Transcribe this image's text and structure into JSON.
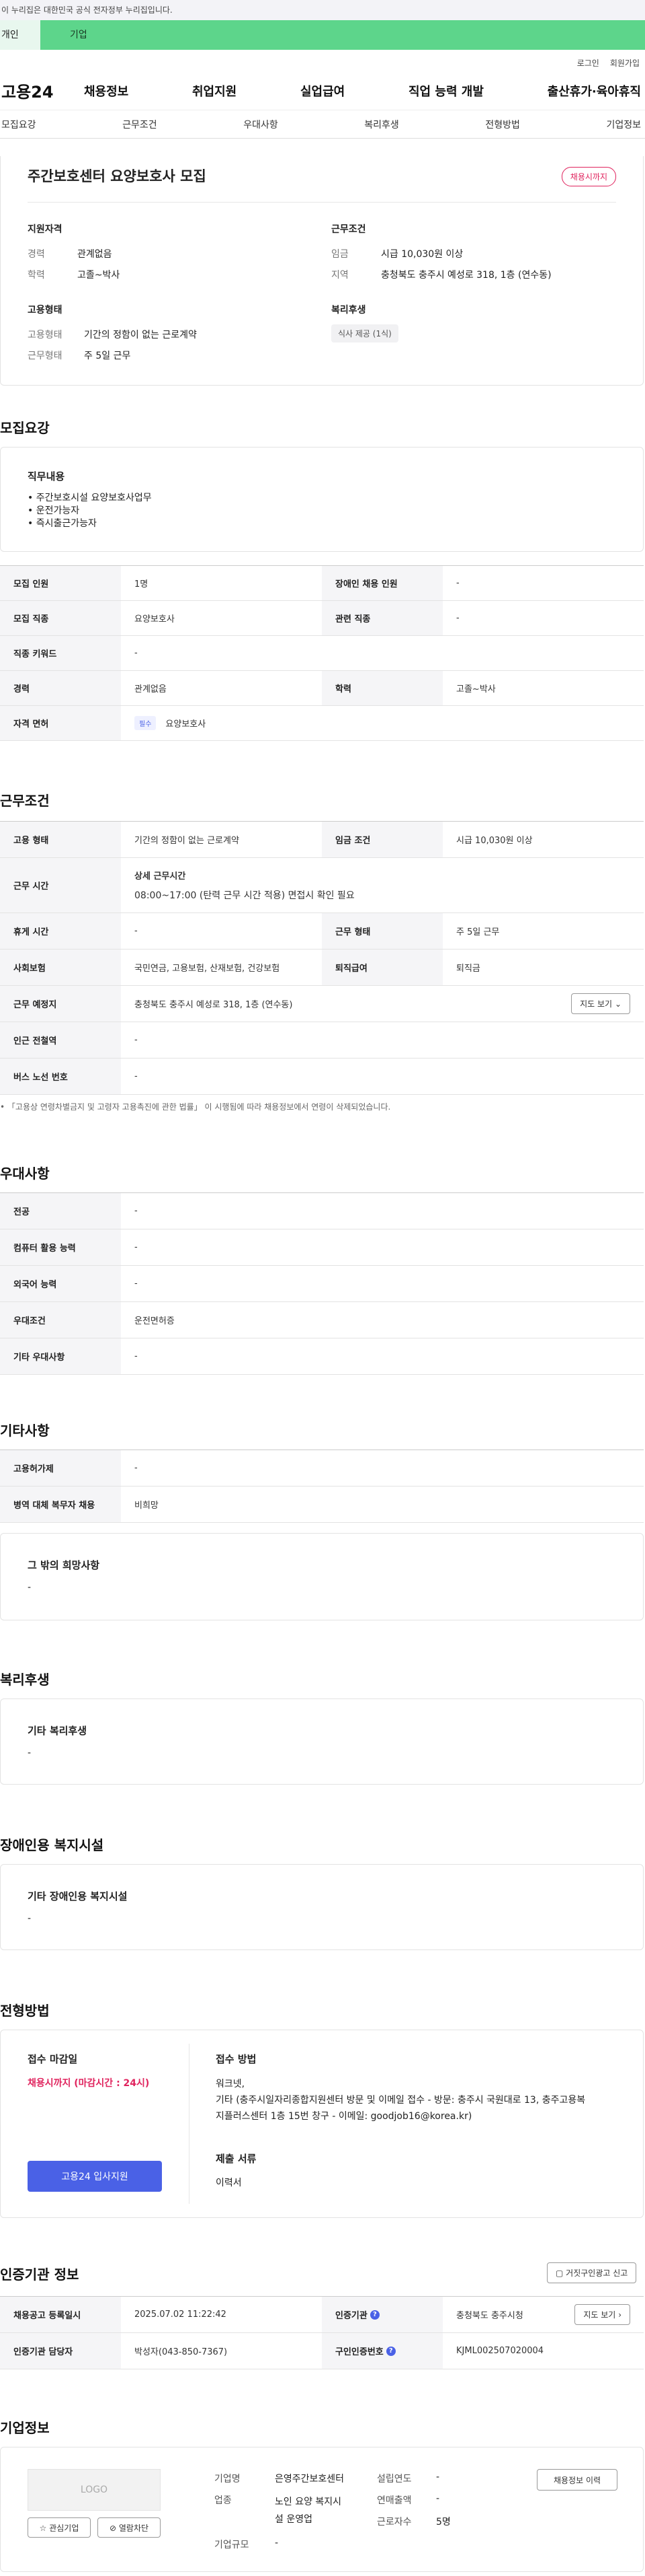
{
  "gov_banner": "이 누리집은 대한민국 공식 전자정부 누리집입니다.",
  "tabs": {
    "a": "개인",
    "b": "기업"
  },
  "util": {
    "login": "로그인",
    "signup": "회원가입"
  },
  "gnb": {
    "logo": "고용24",
    "menu": [
      "채용정보",
      "취업지원",
      "실업급여",
      "직업 능력 개발",
      "출산휴가·육아휴직"
    ]
  },
  "lnb": [
    "모집요강",
    "근무조건",
    "우대사항",
    "복리후생",
    "전형방법",
    "기업정보"
  ],
  "top": {
    "title": "주간보호센터 요양보호사 모집",
    "badge": "채용시까지",
    "qual_h": "지원자격",
    "career_k": "경력",
    "career_v": "관계없음",
    "edu_k": "학력",
    "edu_v": "고졸~박사",
    "emp_h": "고용형태",
    "emptype_k": "고용형태",
    "emptype_v": "기간의 정함이 없는 근로계약",
    "worktype_k": "근무형태",
    "worktype_v": "주 5일 근무",
    "cond_h": "근무조건",
    "wage_k": "임금",
    "wage_v": "시급 10,030원 이상",
    "region_k": "지역",
    "region_v": "충청북도 충주시 예성로 318, 1층 (연수동)",
    "welfare_h": "복리후생",
    "welfare_chip": "식사 제공 (1식)"
  },
  "recruit": {
    "heading": "모집요강",
    "duty_h": "직무내용",
    "duty_lines": [
      "• 주간보호시설 요양보호사업무",
      "• 운전가능자",
      "• 즉시출근가능자"
    ],
    "t": {
      "count_k": "모집 인원",
      "count_v": "1명",
      "disabled_k": "장애인 채용 인원",
      "disabled_v": "-",
      "job_k": "모집 직종",
      "job_v": "요양보호사",
      "related_k": "관련 직종",
      "related_v": "-",
      "kw_k": "직종 키워드",
      "kw_v": "-",
      "career_k": "경력",
      "career_v": "관계없음",
      "edu_k": "학력",
      "edu_v": "고졸~박사",
      "license_k": "자격 면허",
      "license_tag": "필수",
      "license_v": "요양보호사"
    }
  },
  "work": {
    "heading": "근무조건",
    "t": {
      "emptype_k": "고용 형태",
      "emptype_v": "기간의 정함이 없는 근로계약",
      "wage_k": "임금 조건",
      "wage_v": "시급 10,030원 이상",
      "time_k": "근무 시간",
      "time_sub": "상세 근무시간",
      "time_v": "08:00~17:00 (탄력 근무 시간 적용) 면접시 확인 필요",
      "rest_k": "휴게 시간",
      "rest_v": "-",
      "form_k": "근무 형태",
      "form_v": "주 5일 근무",
      "ins_k": "사회보험",
      "ins_v": "국민연금, 고용보험, 산재보험, 건강보험",
      "sev_k": "퇴직급여",
      "sev_v": "퇴직금",
      "place_k": "근무 예정지",
      "place_v": "충청북도 충주시 예성로 318, 1층 (연수동)",
      "map_btn": "지도 보기",
      "subway_k": "인근 전철역",
      "subway_v": "-",
      "bus_k": "버스 노선 번호",
      "bus_v": "-"
    },
    "note": "「고용상 연령차별금지 및 고령자 고용촉진에 관한 법률」 이 시행됨에 따라 채용정보에서 연령이 삭제되었습니다."
  },
  "pref": {
    "heading": "우대사항",
    "rows": [
      [
        "전공",
        "-"
      ],
      [
        "컴퓨터 활용 능력",
        "-"
      ],
      [
        "외국어 능력",
        "-"
      ],
      [
        "우대조건",
        "운전면허증"
      ],
      [
        "기타 우대사항",
        "-"
      ]
    ]
  },
  "etc": {
    "heading": "기타사항",
    "rows": [
      [
        "고용허가제",
        "-"
      ],
      [
        "병역 대체 복무자 채용",
        "비희망"
      ]
    ],
    "wish_h": "그 밖의 희망사항",
    "wish_v": "-"
  },
  "welfare": {
    "heading": "복리후생",
    "h": "기타 복리후생",
    "v": "-"
  },
  "facility": {
    "heading": "장애인용 복지시설",
    "h": "기타 장애인용 복지시설",
    "v": "-"
  },
  "method": {
    "heading": "전형방법",
    "deadline_h": "접수 마감일",
    "deadline_v": "채용시까지 (마감시간 : 24시)",
    "apply_btn": "고용24 입사지원",
    "how_h": "접수 방법",
    "how_l1": "워크넷,",
    "how_l2": "기타 (충주시일자리종합지원센터 방문 및 이메일 접수 - 방문: 충주시 국원대로 13, 충주고용복",
    "how_l3": "지플러스센터 1층 15번 창구 - 이메일: goodjob16@korea.kr)",
    "docs_h": "제출 서류",
    "docs_v": "이력서"
  },
  "cert": {
    "heading": "인증기관 정보",
    "report_btn": "거짓구인광고 신고",
    "reg_k": "채용공고 등록일시",
    "reg_v": "2025.07.02 11:22:42",
    "org_k": "인증기관",
    "org_v": "충청북도 충주시청",
    "map_btn": "지도 보기",
    "mgr_k": "인증기관 담당자",
    "mgr_v": "박성자(043-850-7367)",
    "no_k": "구인인증번호",
    "no_v": "KJML002507020004"
  },
  "company": {
    "heading": "기업정보",
    "logo": "LOGO",
    "fav_btn": "관심기업",
    "block_btn": "열람차단",
    "history_btn": "채용정보 이력",
    "name_k": "기업명",
    "name_v": "은영주간보호센터",
    "ind_k": "업종",
    "ind_v1": "노인 요양 복지시",
    "ind_v2": "설 운영업",
    "size_k": "기업규모",
    "size_v": "-",
    "est_k": "설립연도",
    "est_v": "-",
    "sales_k": "연매출액",
    "sales_v": "-",
    "emp_k": "근로자수",
    "emp_v": "5명"
  },
  "colors": {
    "accent": "#4a61e6",
    "green": "#5dd58b",
    "red": "#e0245e"
  }
}
